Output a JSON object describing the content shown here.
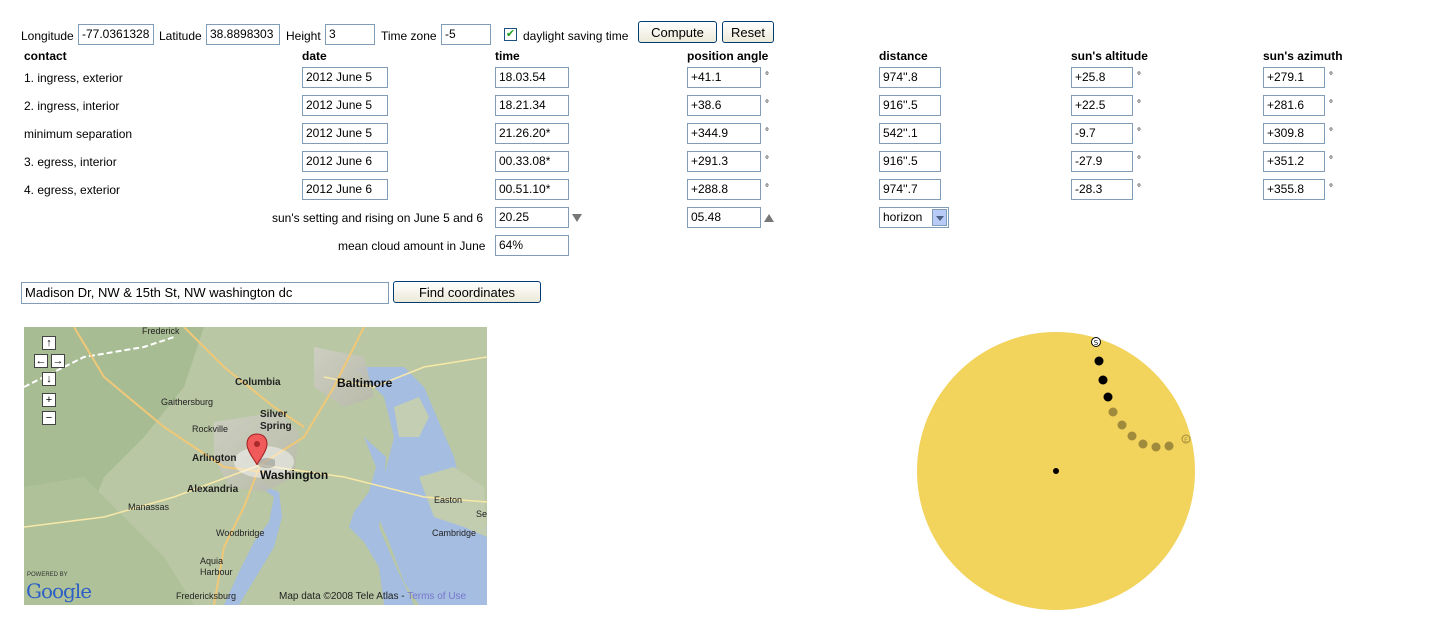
{
  "location": {
    "longitude_label": "Longitude",
    "longitude_value": "-77.0361328",
    "latitude_label": "Latitude",
    "latitude_value": "38.8898303",
    "height_label": "Height",
    "height_value": "3",
    "timezone_label": "Time zone",
    "timezone_value": "-5",
    "dst_label": "daylight saving time",
    "dst_checked": true,
    "compute_label": "Compute",
    "reset_label": "Reset"
  },
  "table": {
    "headers": [
      "contact",
      "date",
      "time",
      "position angle",
      "distance",
      "sun's altitude",
      "sun's azimuth"
    ],
    "degree_symbol": "°",
    "rows": [
      {
        "contact": "1. ingress, exterior",
        "date": "2012 June 5",
        "time": "18.03.54",
        "pa": "+41.1",
        "distance": "974''.8",
        "altitude": "+25.8",
        "azimuth": "+279.1"
      },
      {
        "contact": "2. ingress, interior",
        "date": "2012 June 5",
        "time": "18.21.34",
        "pa": "+38.6",
        "distance": "916''.5",
        "altitude": "+22.5",
        "azimuth": "+281.6"
      },
      {
        "contact": "minimum separation",
        "date": "2012 June 5",
        "time": "21.26.20*",
        "pa": "+344.9",
        "distance": "542''.1",
        "altitude": "-9.7",
        "azimuth": "+309.8"
      },
      {
        "contact": "3. egress, interior",
        "date": "2012 June 6",
        "time": "00.33.08*",
        "pa": "+291.3",
        "distance": "916''.5",
        "altitude": "-27.9",
        "azimuth": "+351.2"
      },
      {
        "contact": "4. egress, exterior",
        "date": "2012 June 6",
        "time": "00.51.10*",
        "pa": "+288.8",
        "distance": "974''.7",
        "altitude": "-28.3",
        "azimuth": "+355.8"
      }
    ],
    "sun_label": "sun's setting and rising on June 5 and 6",
    "sunset": "20.25",
    "sunrise": "05.48",
    "horizon_option": "horizon",
    "cloud_label": "mean cloud amount in June",
    "cloud_value": "64%"
  },
  "search": {
    "address": "Madison Dr, NW & 15th St, NW washington dc",
    "button_label": "Find coordinates"
  },
  "map": {
    "cities": {
      "frederick": "Frederick",
      "columbia": "Columbia",
      "baltimore": "Baltimore",
      "gaithersburg": "Gaithersburg",
      "silver_spring": "Silver Spring",
      "rockville": "Rockville",
      "arlington": "Arlington",
      "washington": "Washington",
      "alexandria": "Alexandria",
      "manassas": "Manassas",
      "woodbridge": "Woodbridge",
      "aquia_harbour": "Aquia Harbour",
      "fredericksburg": "Fredericksburg",
      "easton": "Easton",
      "cambridge": "Cambridge",
      "se": "Se"
    },
    "powered_by": "POWERED BY",
    "google": "Google",
    "copyright": "Map data ©2008 Tele Atlas - ",
    "terms": "Terms of Use"
  },
  "transit_diagram": {
    "disk_color": "#f2d35c",
    "visible_color": "#000000",
    "below_horizon_color": "#a08a3c",
    "start_marker": "S",
    "end_marker": "E"
  }
}
